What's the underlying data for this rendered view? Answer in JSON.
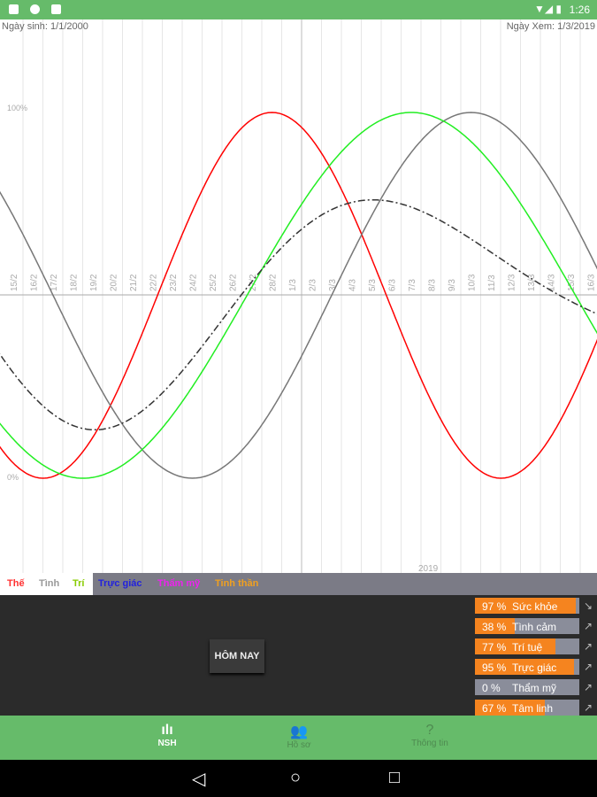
{
  "status_bar": {
    "time": "1:26",
    "icons": [
      "a-icon",
      "circle-icon",
      "sd-card-icon",
      "wifi-icon",
      "signal-icon",
      "battery-icon"
    ]
  },
  "header": {
    "birth_date": "Ngày sinh: 1/1/2000",
    "view_date": "Ngày Xem: 1/3/2019"
  },
  "chart_data": {
    "type": "line",
    "x_ticks": [
      "15/2",
      "16/2",
      "17/2",
      "18/2",
      "19/2",
      "20/2",
      "21/2",
      "22/2",
      "23/2",
      "24/2",
      "25/2",
      "26/2",
      "27/2",
      "28/2",
      "1/3",
      "2/3",
      "3/3",
      "4/3",
      "5/3",
      "6/3",
      "7/3",
      "8/3",
      "9/3",
      "10/3",
      "11/3",
      "12/3",
      "13/3",
      "14/3",
      "15/3",
      "16/3"
    ],
    "y_labels": [
      "100%",
      "0%"
    ],
    "ylim": [
      0,
      100
    ],
    "year_label": "2019",
    "selected_date": "1/3",
    "series": [
      {
        "name": "Thế",
        "color": "#ff0000",
        "period_days": 23,
        "peak_date": "28/2"
      },
      {
        "name": "Tình",
        "color": "#777777",
        "period_days": 28,
        "peak_date": "10/3"
      },
      {
        "name": "Trí",
        "color": "#22ee22",
        "period_days": 33,
        "peak_date": "7/3"
      },
      {
        "name": "",
        "color": "#333333",
        "style": "dash-dot",
        "peak_date": "5/3"
      }
    ]
  },
  "legend_tabs": [
    {
      "label": "Thế",
      "color": "#ff3030"
    },
    {
      "label": "Tình",
      "color": "#999999"
    },
    {
      "label": "Trí",
      "color": "#88cc00"
    },
    {
      "label": "Trực giác",
      "color": "#2222dd"
    },
    {
      "label": "Thẩm mỹ",
      "color": "#ee22ee"
    },
    {
      "label": "Tinh thần",
      "color": "#f0a020"
    }
  ],
  "today_button": "HÔM NAY",
  "indicators": [
    {
      "percent": "97 %",
      "value": 97,
      "name": "Sức khỏe",
      "trend": "down"
    },
    {
      "percent": "38 %",
      "value": 38,
      "name": "Tình cảm",
      "trend": "up"
    },
    {
      "percent": "77 %",
      "value": 77,
      "name": "Trí tuệ",
      "trend": "up"
    },
    {
      "percent": "95 %",
      "value": 95,
      "name": "Trực giác",
      "trend": "up"
    },
    {
      "percent": "0 %",
      "value": 0,
      "name": "Thẩm mỹ",
      "trend": "up"
    },
    {
      "percent": "67 %",
      "value": 67,
      "name": "Tâm linh",
      "trend": "up"
    }
  ],
  "bottom_nav": [
    {
      "label": "NSH",
      "icon": "waveform-icon",
      "active": true
    },
    {
      "label": "Hồ sơ",
      "icon": "people-icon",
      "active": false
    },
    {
      "label": "Thông tin",
      "icon": "help-icon",
      "active": false
    }
  ]
}
